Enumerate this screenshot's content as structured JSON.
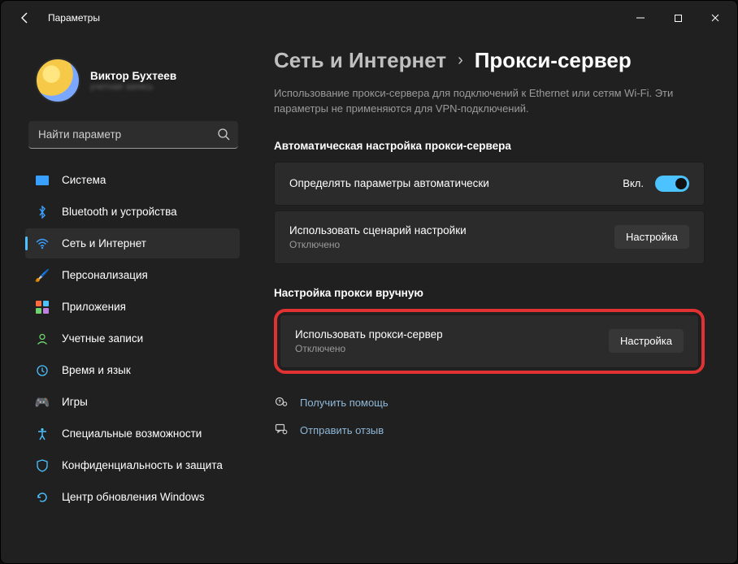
{
  "window": {
    "title": "Параметры"
  },
  "profile": {
    "name": "Виктор Бухтеев",
    "sub": "учетная запись"
  },
  "search": {
    "placeholder": "Найти параметр"
  },
  "nav": {
    "items": [
      {
        "label": "Система"
      },
      {
        "label": "Bluetooth и устройства"
      },
      {
        "label": "Сеть и Интернет"
      },
      {
        "label": "Персонализация"
      },
      {
        "label": "Приложения"
      },
      {
        "label": "Учетные записи"
      },
      {
        "label": "Время и язык"
      },
      {
        "label": "Игры"
      },
      {
        "label": "Специальные возможности"
      },
      {
        "label": "Конфиденциальность и защита"
      },
      {
        "label": "Центр обновления Windows"
      }
    ]
  },
  "breadcrumb": {
    "parent": "Сеть и Интернет",
    "current": "Прокси-сервер"
  },
  "description": "Использование прокси-сервера для подключений к Ethernet или сетям Wi-Fi. Эти параметры не применяются для VPN-подключений.",
  "sections": {
    "auto_title": "Автоматическая настройка прокси-сервера",
    "manual_title": "Настройка прокси вручную"
  },
  "cards": {
    "autodetect": {
      "label": "Определять параметры автоматически",
      "state": "Вкл."
    },
    "script": {
      "label": "Использовать сценарий настройки",
      "sub": "Отключено",
      "button": "Настройка"
    },
    "proxy": {
      "label": "Использовать прокси-сервер",
      "sub": "Отключено",
      "button": "Настройка"
    }
  },
  "footer": {
    "help": "Получить помощь",
    "feedback": "Отправить отзыв"
  }
}
